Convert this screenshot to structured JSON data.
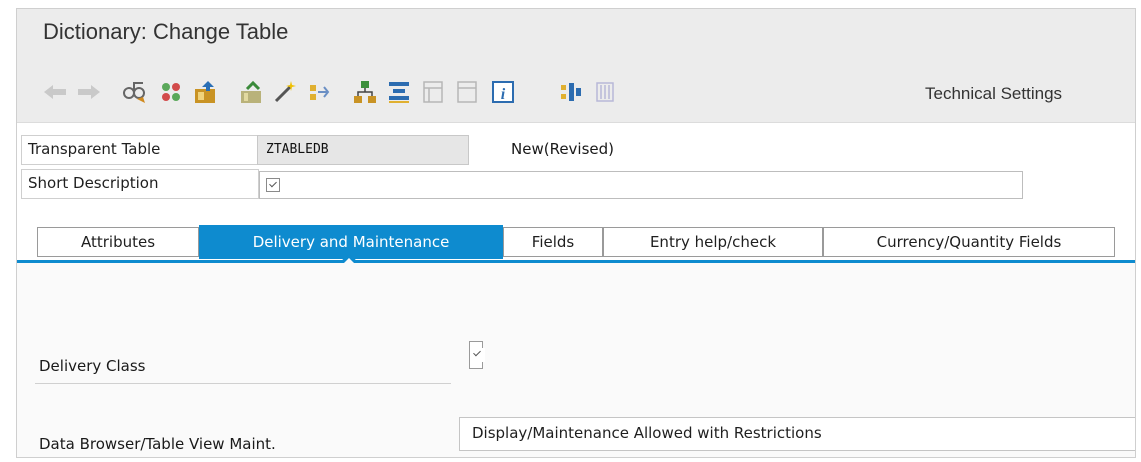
{
  "window": {
    "title": "Dictionary: Change Table"
  },
  "toolbar": {
    "icons": [
      "back-arrow-icon",
      "forward-arrow-icon",
      "display-change-icon",
      "activate-icon",
      "where-used-icon",
      "object-list-icon",
      "check-icon",
      "magic-wand-icon",
      "navigate-icon",
      "hierarchy-icon",
      "append-structure-icon",
      "layout-icon",
      "info-icon",
      "tree-icon",
      "contents-icon"
    ],
    "technical_settings_label": "Technical Settings"
  },
  "header": {
    "transparent_table_label": "Transparent Table",
    "table_name": "ZTABLEDB",
    "status": "New(Revised)",
    "short_description_label": "Short Description",
    "short_description_value": ""
  },
  "tabs": [
    {
      "label": "Attributes",
      "active": false
    },
    {
      "label": "Delivery and Maintenance",
      "active": true
    },
    {
      "label": "Fields",
      "active": false
    },
    {
      "label": "Entry help/check",
      "active": false
    },
    {
      "label": "Currency/Quantity Fields",
      "active": false
    }
  ],
  "delivery": {
    "delivery_class_label": "Delivery Class",
    "delivery_class_value": "",
    "data_browser_label": "Data Browser/Table View Maint.",
    "data_browser_value": "Display/Maintenance Allowed with Restrictions"
  },
  "colors": {
    "accent": "#0e8bcf",
    "toolbar_bg": "#ececec"
  }
}
